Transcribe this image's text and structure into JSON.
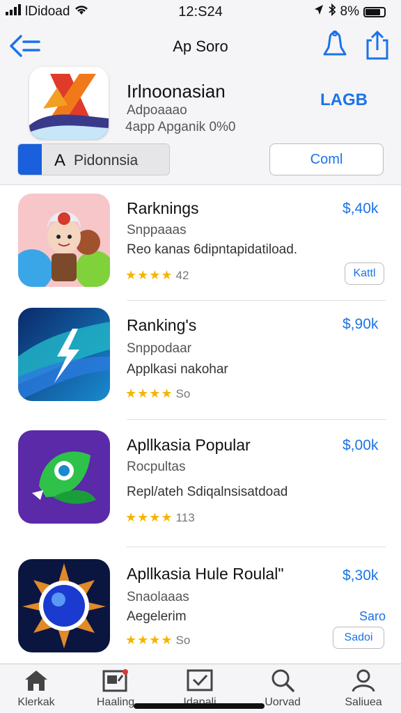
{
  "status_bar": {
    "carrier": "lDidoad",
    "time": "12:S24",
    "battery": "8%"
  },
  "nav": {
    "title": "Ap Soro",
    "icons": [
      "back-icon",
      "bell-icon",
      "share-icon"
    ]
  },
  "header": {
    "app_name": "Irlnoonasian",
    "subtitle": "Adpoaaao",
    "meta": "4app Apganik 0%0",
    "get_label": "LAGB",
    "search_letter": "A",
    "search_text": "Pidonnsia",
    "button_label": "Coml"
  },
  "items": [
    {
      "title": "Rarknings",
      "subtitle": "Snppaaas",
      "description": "Reo kanas 6dipntapidatiload.",
      "stars": "★★★★",
      "count": "42",
      "price": "$,40k",
      "button": "Kattl",
      "icon": "character-icon"
    },
    {
      "title": "Ranking's",
      "subtitle": "Snppodaar",
      "description": "Applkasi nakohar",
      "stars": "★★★★",
      "count": "So",
      "price": "$,90k",
      "icon": "bolt-icon"
    },
    {
      "title": "Apllkasia Popular",
      "subtitle": "Rocpultas",
      "description": "Repl/ateh Sdiqalnsisatdoad",
      "stars": "★★★★",
      "count": "113",
      "price": "$,00k",
      "icon": "bird-icon"
    },
    {
      "title": "Apllkasia Hule Roulal\"",
      "subtitle": "Snaolaaas",
      "description": "Aegelerim",
      "stars": "★★★★",
      "count": "So",
      "price": "$,30k",
      "link": "Saro",
      "button": "Sadoi",
      "icon": "compass-icon"
    }
  ],
  "tabs": [
    {
      "label": "Klerkak",
      "icon": "home-icon"
    },
    {
      "label": "Haaling",
      "icon": "news-icon"
    },
    {
      "label": "Idapali",
      "icon": "check-icon"
    },
    {
      "label": "Uorvad",
      "icon": "search-icon"
    },
    {
      "label": "Saliuea",
      "icon": "person-icon"
    }
  ],
  "colors": {
    "accent": "#1a73e8",
    "star": "#f5b400",
    "background": "#f5f5f7"
  }
}
